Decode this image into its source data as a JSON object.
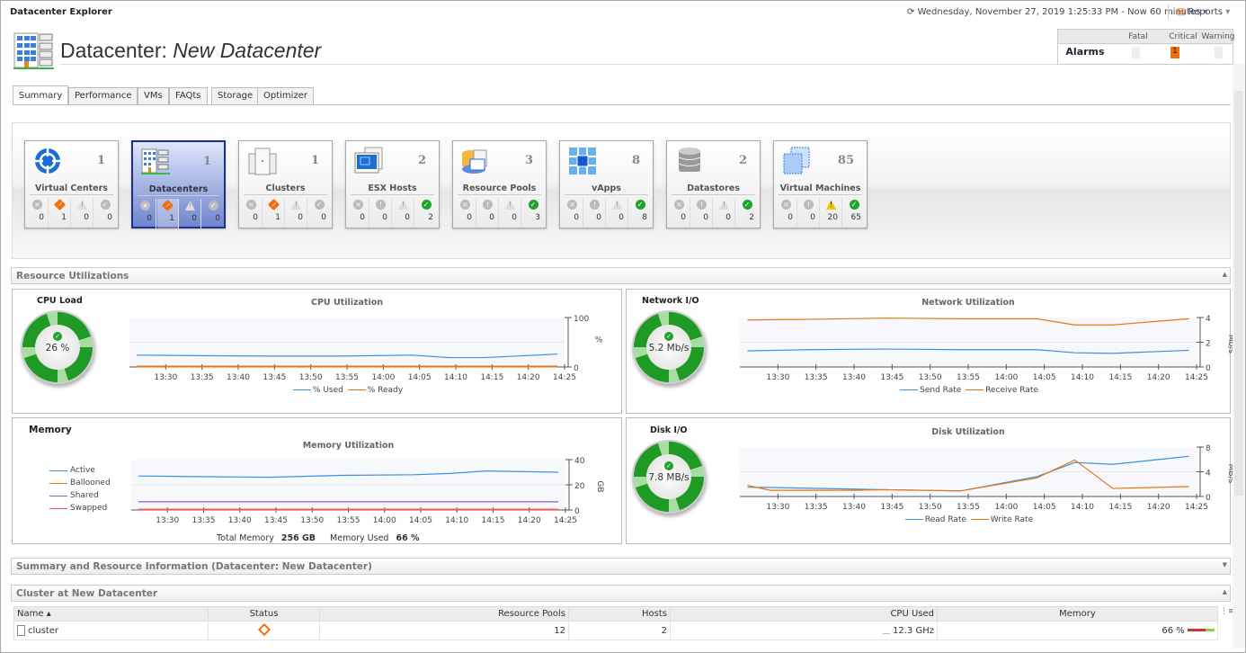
{
  "app_title": "Datacenter Explorer",
  "timebar": {
    "label": "Wednesday, November 27, 2019 1:25:33 PM - Now 60 minutes",
    "icon": "refresh-clock-icon"
  },
  "reports": {
    "label": "Reports",
    "icon": "report-icon"
  },
  "page": {
    "prefix": "Datacenter:",
    "name": "New Datacenter"
  },
  "alarms": {
    "label": "Alarms",
    "columns": [
      "Fatal",
      "Critical",
      "Warning"
    ],
    "values": [
      "",
      "1",
      ""
    ],
    "critical_color": "#f07010"
  },
  "tabs": [
    "Summary",
    "Performance",
    "VMs",
    "FAQts",
    "Storage",
    "Optimizer"
  ],
  "active_tab": "Summary",
  "tiles": [
    {
      "name": "Virtual Centers",
      "count": "1",
      "status": [
        "0",
        "1",
        "0",
        "0"
      ],
      "icon": "virtual-center-icon"
    },
    {
      "name": "Datacenters",
      "count": "1",
      "status": [
        "0",
        "1",
        "0",
        "0"
      ],
      "icon": "datacenter-icon",
      "selected": true
    },
    {
      "name": "Clusters",
      "count": "1",
      "status": [
        "0",
        "1",
        "0",
        "0"
      ],
      "icon": "cluster-icon"
    },
    {
      "name": "ESX Hosts",
      "count": "2",
      "status": [
        "0",
        "0",
        "0",
        "2"
      ],
      "icon": "esx-host-icon"
    },
    {
      "name": "Resource Pools",
      "count": "3",
      "status": [
        "0",
        "0",
        "0",
        "3"
      ],
      "icon": "resource-pool-icon"
    },
    {
      "name": "vApps",
      "count": "8",
      "status": [
        "0",
        "0",
        "0",
        "8"
      ],
      "icon": "vapp-icon"
    },
    {
      "name": "Datastores",
      "count": "2",
      "status": [
        "0",
        "0",
        "0",
        "2"
      ],
      "icon": "datastore-icon"
    },
    {
      "name": "Virtual Machines",
      "count": "85",
      "status": [
        "0",
        "0",
        "20",
        "65"
      ],
      "icon": "virtual-machine-icon"
    }
  ],
  "sections": {
    "resource": "Resource Utilizations",
    "summary": "Summary and Resource Information (Datacenter: New Datacenter)",
    "cluster": "Cluster at New Datacenter"
  },
  "gauges": {
    "cpu": {
      "title": "CPU Load",
      "value": "26 %"
    },
    "network": {
      "title": "Network I/O",
      "value": "5.2 Mb/s"
    },
    "disk": {
      "title": "Disk I/O",
      "value": "7.8 MB/s"
    },
    "memory": {
      "title": "Memory"
    }
  },
  "memory_footer": {
    "total_label": "Total Memory",
    "total": "256 GB",
    "used_label": "Memory Used",
    "used": "66 %"
  },
  "chart_data": [
    {
      "id": "cpu",
      "type": "line",
      "title": "CPU Utilization",
      "ylabel": "%",
      "ylim": [
        0,
        100
      ],
      "yticks": [
        "0",
        "100"
      ],
      "xticks": [
        "13:30",
        "13:35",
        "13:40",
        "13:45",
        "13:50",
        "13:55",
        "14:00",
        "14:05",
        "14:10",
        "14:15",
        "14:20",
        "14:25"
      ],
      "x": [
        "13:26",
        "13:34",
        "13:44",
        "13:54",
        "14:04",
        "14:09",
        "14:14",
        "14:24"
      ],
      "series": [
        {
          "name": "% Used",
          "color": "#3c8ee6",
          "values": [
            24,
            23,
            22,
            22,
            24,
            19,
            19,
            26
          ]
        },
        {
          "name": "% Ready",
          "color": "#e8760e",
          "values": [
            1,
            1,
            1,
            1,
            1,
            1,
            1,
            1
          ]
        }
      ],
      "legend": "bottom"
    },
    {
      "id": "net",
      "type": "line",
      "title": "Network Utilization",
      "ylabel": "Mb/s",
      "ylim": [
        0,
        4
      ],
      "yticks": [
        "0",
        "2",
        "4"
      ],
      "xticks": [
        "13:30",
        "13:35",
        "13:40",
        "13:45",
        "13:50",
        "13:55",
        "14:00",
        "14:05",
        "14:10",
        "14:15",
        "14:20",
        "14:25"
      ],
      "x": [
        "13:26",
        "13:34",
        "13:44",
        "13:54",
        "14:04",
        "14:09",
        "14:14",
        "14:24"
      ],
      "series": [
        {
          "name": "Send Rate",
          "color": "#3c8ee6",
          "values": [
            1.3,
            1.4,
            1.45,
            1.4,
            1.4,
            1.15,
            1.1,
            1.35
          ]
        },
        {
          "name": "Receive Rate",
          "color": "#e8760e",
          "values": [
            3.8,
            3.85,
            3.95,
            3.9,
            3.9,
            3.4,
            3.4,
            3.9
          ]
        }
      ],
      "legend": "bottom"
    },
    {
      "id": "mem",
      "type": "line",
      "title": "Memory Utilization",
      "ylabel": "GB",
      "ylim": [
        0,
        40
      ],
      "yticks": [
        "0",
        "20",
        "40"
      ],
      "xticks": [
        "13:30",
        "13:35",
        "13:40",
        "13:45",
        "13:50",
        "13:55",
        "14:00",
        "14:05",
        "14:10",
        "14:15",
        "14:20",
        "14:25"
      ],
      "x": [
        "13:26",
        "13:34",
        "13:44",
        "13:54",
        "14:04",
        "14:09",
        "14:14",
        "14:24"
      ],
      "series": [
        {
          "name": "Active",
          "color": "#3c8ee6",
          "values": [
            27,
            26.5,
            26,
            27.5,
            28,
            29,
            31,
            30
          ]
        },
        {
          "name": "Ballooned",
          "color": "#e8760e",
          "values": [
            0.4,
            0.4,
            0.4,
            0.4,
            0.4,
            0.4,
            0.4,
            0.4
          ]
        },
        {
          "name": "Shared",
          "color": "#8a5cd0",
          "values": [
            6.5,
            6.5,
            6.5,
            6.5,
            6.5,
            6.5,
            6.5,
            6.5
          ]
        },
        {
          "name": "Swapped",
          "color": "#f0509a",
          "values": [
            0,
            0,
            0,
            0,
            0,
            0,
            0,
            0
          ]
        }
      ],
      "legend": "left"
    },
    {
      "id": "disk",
      "type": "line",
      "title": "Disk Utilization",
      "ylabel": "MB/s",
      "ylim": [
        0,
        8
      ],
      "yticks": [
        "0",
        "4",
        "8"
      ],
      "xticks": [
        "13:30",
        "13:35",
        "13:40",
        "13:45",
        "13:50",
        "13:55",
        "14:00",
        "14:05",
        "14:10",
        "14:15",
        "14:20",
        "14:25"
      ],
      "x": [
        "13:26",
        "13:29",
        "13:40",
        "13:44",
        "13:54",
        "14:04",
        "14:09",
        "14:14",
        "14:24"
      ],
      "series": [
        {
          "name": "Read Rate",
          "color": "#3c8ee6",
          "values": [
            1.5,
            1.45,
            1.2,
            1.1,
            0.9,
            3.2,
            5.5,
            5.2,
            6.5
          ]
        },
        {
          "name": "Write Rate",
          "color": "#e8760e",
          "values": [
            1.8,
            1.0,
            1.0,
            1.1,
            0.9,
            3.0,
            5.9,
            1.3,
            1.6
          ]
        }
      ],
      "legend": "bottom"
    }
  ],
  "cluster_table": {
    "columns": [
      "Name",
      "Status",
      "Resource Pools",
      "Hosts",
      "CPU Used",
      "Memory"
    ],
    "sort": "Name ascending",
    "rows": [
      {
        "name": "cluster",
        "status": "critical",
        "resource_pools": "12",
        "hosts": "2",
        "cpu_used": "12.3 GHz",
        "memory": "66 %",
        "memory_pct": 66
      }
    ]
  }
}
